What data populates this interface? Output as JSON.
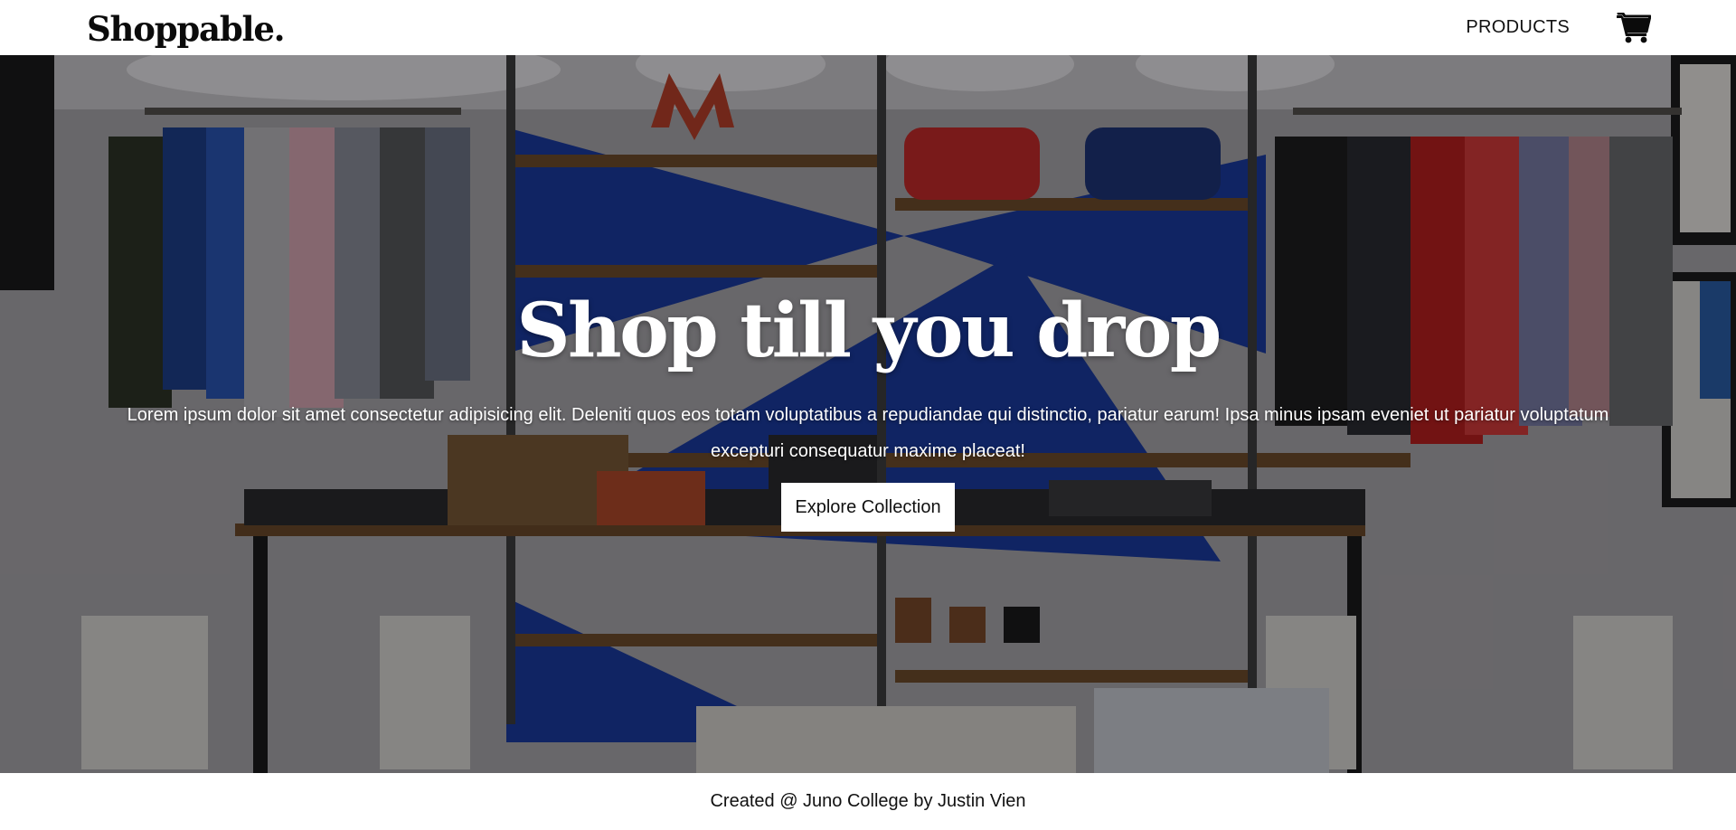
{
  "header": {
    "logo": "Shoppable.",
    "nav": {
      "products_label": "PRODUCTS",
      "cart_icon": "shopping-cart-icon"
    }
  },
  "hero": {
    "title": "Shop till you drop",
    "text": "Lorem ipsum dolor sit amet consectetur adipisicing elit. Deleniti quos eos totam voluptatibus a repudiandae qui distinctio, pariatur earum! Ipsa minus ipsam eveniet ut pariatur voluptatum excepturi consequatur maxime placeat!",
    "button_label": "Explore Collection",
    "background": "clothing-store-photo"
  },
  "footer": {
    "credit": "Created @ Juno College by Justin Vien"
  },
  "colors": {
    "header_bg": "#ffffff",
    "text_dark": "#111111",
    "hero_text": "#ffffff",
    "button_bg": "#ffffff"
  }
}
